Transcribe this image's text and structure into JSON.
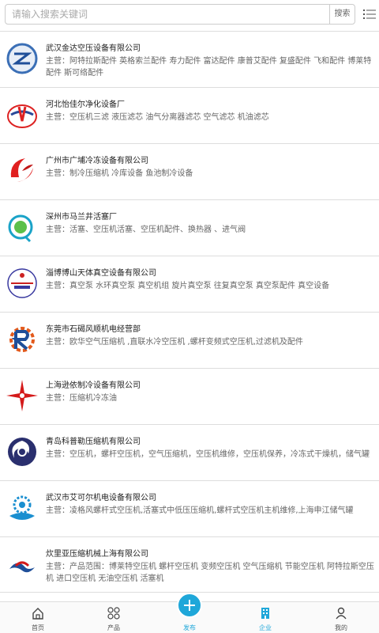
{
  "search": {
    "placeholder": "请输入搜索关键词",
    "button_label": "搜索"
  },
  "companies": [
    {
      "name": "武汉金达空压设备有限公司",
      "desc": "主营：阿特拉斯配件 英格索兰配件 寿力配件 富达配件 康普艾配件 复盛配件 飞和配件 博莱特配件 斯可络配件"
    },
    {
      "name": "河北怡佳尔净化设备厂",
      "desc": "主营：空压机三滤 液压滤芯 油气分离器滤芯 空气滤芯 机油滤芯"
    },
    {
      "name": "广州市广埔冷冻设备有限公司",
      "desc": "主营：制冷压缩机 冷库设备 鱼池制冷设备"
    },
    {
      "name": "深州市马兰井活塞厂",
      "desc": "主营：活塞、空压机活塞、空压机配件、换热器 、进气阀"
    },
    {
      "name": "淄博博山天体真空设备有限公司",
      "desc": "主营：真空泵 水环真空泵 真空机组 旋片真空泵 往复真空泵 真空泵配件 真空设备"
    },
    {
      "name": "东莞市石碣风顺机电经营部",
      "desc": "主营：欧华空气压缩机 ,直联水冷空压机 ,螺杆变频式空压机,过滤机及配件"
    },
    {
      "name": "上海逊依制冷设备有限公司",
      "desc": "主营：压缩机冷冻油"
    },
    {
      "name": "青岛科普勒压缩机有限公司",
      "desc": "主营：空压机，螺杆空压机，空气压缩机，空压机维修，空压机保养，冷冻式干燥机，储气罐"
    },
    {
      "name": "武汉市艾可尔机电设备有限公司",
      "desc": "主营：凌格风螺杆式空压机,活塞式中低压压缩机,螺杆式空压机主机维修,上海申江储气罐"
    },
    {
      "name": "炊里亚压缩机械上海有限公司",
      "desc": "主营：产品范围：博莱特空压机 螺杆空压机 变频空压机 空气压缩机 节能空压机 阿特拉斯空压机 进口空压机 无油空压机 活塞机"
    }
  ],
  "tabbar": {
    "home": "首页",
    "products": "产品",
    "publish": "发布",
    "enterprise": "企业",
    "mine": "我的"
  },
  "colors": {
    "accent": "#1fa7d9",
    "border": "#dddddd"
  }
}
